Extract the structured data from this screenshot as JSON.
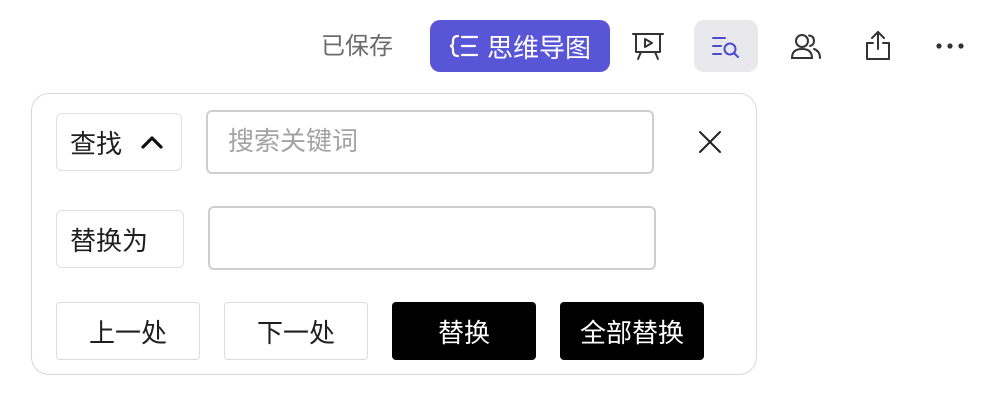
{
  "toolbar": {
    "saved_status": "已保存",
    "mindmap_label": "思维导图",
    "icons": [
      "mindmap-icon",
      "present-icon",
      "find-replace-icon",
      "collaborators-icon",
      "share-icon",
      "more-icon"
    ],
    "accent_color": "#5856d6"
  },
  "find_panel": {
    "mode_label": "查找",
    "search": {
      "placeholder": "搜索关键词",
      "value": ""
    },
    "replace_label": "替换为",
    "replace": {
      "value": ""
    },
    "buttons": {
      "previous": "上一处",
      "next": "下一处",
      "replace": "替换",
      "replace_all": "全部替换"
    }
  }
}
